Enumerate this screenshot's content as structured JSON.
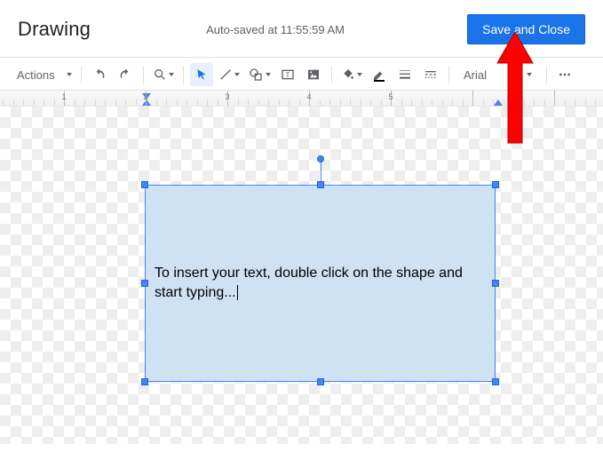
{
  "header": {
    "title": "Drawing",
    "autosave": "Auto-saved at 11:55:59 AM",
    "primary_button": "Save and Close"
  },
  "toolbar": {
    "actions_label": "Actions",
    "font_name": "Arial"
  },
  "ruler": {
    "numbers": [
      "1",
      "2",
      "3",
      "4",
      "5"
    ]
  },
  "shape": {
    "text": "To insert your text, double click on the shape and start typing..."
  }
}
